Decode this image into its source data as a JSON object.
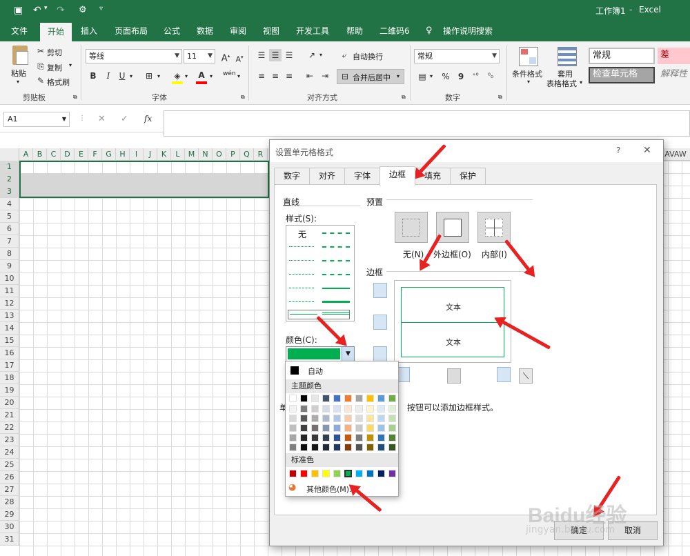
{
  "titlebar": {
    "doc": "工作簿1",
    "sep": "-",
    "app": "Excel"
  },
  "tabs": [
    "文件",
    "开始",
    "插入",
    "页面布局",
    "公式",
    "数据",
    "审阅",
    "视图",
    "开发工具",
    "帮助",
    "二维码6"
  ],
  "tell_me": "操作说明搜索",
  "ribbon": {
    "clipboard": {
      "paste": "粘贴",
      "cut": "剪切",
      "copy": "复制",
      "painter": "格式刷",
      "label": "剪贴板"
    },
    "font": {
      "name": "等线",
      "size": "11",
      "label": "字体",
      "bold": "B",
      "italic": "I",
      "underline": "U",
      "wen": "wén"
    },
    "align": {
      "wrap": "自动换行",
      "merge": "合并后居中",
      "label": "对齐方式"
    },
    "number": {
      "format": "常规",
      "percent": "%",
      "comma": "9",
      "label": "数字"
    },
    "styles": {
      "cond": "条件格式",
      "table1": "套用",
      "table2": "表格格式",
      "normal": "常规",
      "bad": "差",
      "check": "检查单元格",
      "explain": "解释性"
    }
  },
  "namebox": "A1",
  "fx": "fx",
  "columns": [
    "A",
    "B",
    "C",
    "D",
    "E",
    "F",
    "G",
    "H",
    "I",
    "J",
    "K",
    "L",
    "M",
    "N",
    "O",
    "P",
    "Q",
    "R"
  ],
  "right_cols": "AVAW",
  "rows": [
    "1",
    "2",
    "3",
    "4",
    "5",
    "6",
    "7",
    "8",
    "9",
    "10",
    "11",
    "12",
    "13",
    "14",
    "15",
    "16",
    "17",
    "18",
    "19",
    "20",
    "21",
    "22",
    "23",
    "24",
    "25",
    "26",
    "27",
    "28",
    "29",
    "30",
    "31"
  ],
  "dialog": {
    "title": "设置单元格格式",
    "help": "?",
    "close": "✕",
    "tabs": [
      "数字",
      "对齐",
      "字体",
      "边框",
      "填充",
      "保护"
    ],
    "line_section": "直线",
    "style_label": "样式(S):",
    "none": "无",
    "color_label": "颜色(C):",
    "preset_section": "预置",
    "preset_none": "无(N)",
    "preset_outline": "外边框(O)",
    "preset_inside": "内部(I)",
    "border_section": "边框",
    "preview_text_top": "文本",
    "preview_text_bottom": "文本",
    "hint_prefix": "单",
    "hint_suffix": "按钮可以添加边框样式。",
    "ok": "确定",
    "cancel": "取消"
  },
  "palette": {
    "auto": "自动",
    "theme": "主题颜色",
    "standard": "标准色",
    "more": "其他颜色(M)...",
    "theme_top": [
      "#ffffff",
      "#000000",
      "#e7e6e6",
      "#44546a",
      "#4472c4",
      "#ed7d31",
      "#a5a5a5",
      "#ffc000",
      "#5b9bd5",
      "#70ad47"
    ],
    "theme_shades": [
      [
        "#f2f2f2",
        "#d9d9d9",
        "#bfbfbf",
        "#a6a6a6",
        "#808080"
      ],
      [
        "#7f7f7f",
        "#595959",
        "#404040",
        "#262626",
        "#0d0d0d"
      ],
      [
        "#d0cece",
        "#aeabab",
        "#757171",
        "#3a3838",
        "#171616"
      ],
      [
        "#d6dce4",
        "#adb9ca",
        "#8496b0",
        "#333f4f",
        "#222a35"
      ],
      [
        "#d9e2f3",
        "#b4c6e7",
        "#8eaadb",
        "#2f5496",
        "#1f3864"
      ],
      [
        "#fbe5d5",
        "#f7cbac",
        "#f4b183",
        "#c55a11",
        "#833c0b"
      ],
      [
        "#ededed",
        "#dbdbdb",
        "#c9c9c9",
        "#7b7b7b",
        "#525252"
      ],
      [
        "#fff2cc",
        "#fee599",
        "#ffd966",
        "#bf9000",
        "#7f6000"
      ],
      [
        "#deebf6",
        "#bdd7ee",
        "#9dc3e6",
        "#2e75b5",
        "#1f4e79"
      ],
      [
        "#e2efd9",
        "#c5e0b3",
        "#a8d08d",
        "#538135",
        "#375623"
      ]
    ],
    "standard_colors": [
      "#c00000",
      "#ff0000",
      "#ffc000",
      "#ffff00",
      "#92d050",
      "#00b050",
      "#00b0f0",
      "#0070c0",
      "#002060",
      "#7030a0"
    ]
  },
  "accent": "#217346",
  "selected_color": "#00b050",
  "watermark": "Baidu经验",
  "watermark_url": "jingyan.baidu.com"
}
